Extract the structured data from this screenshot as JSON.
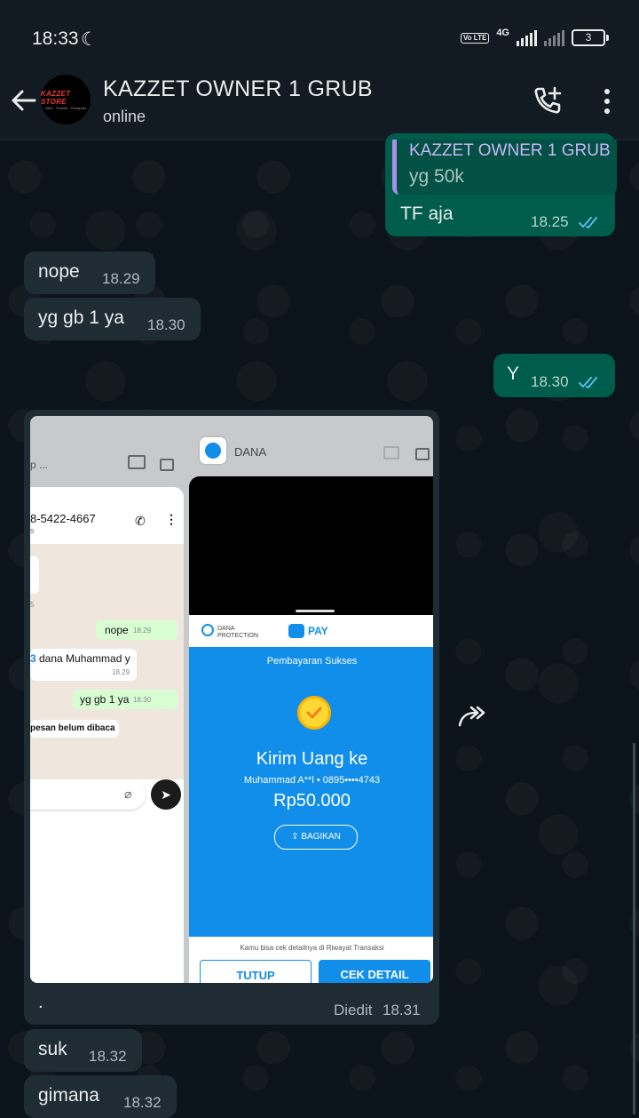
{
  "status": {
    "time": "18:33",
    "net": "4G",
    "volte": "Vo LTE",
    "battery": "3"
  },
  "header": {
    "title": "KAZZET OWNER 1 GRUB",
    "status": "online",
    "avatar_text": "KAZZET STORE",
    "avatar_sub": "Best · Trusted · Cheapest"
  },
  "messages": {
    "m1": {
      "quote_name": "KAZZET OWNER 1 GRUB",
      "quote_text": "yg 50k",
      "text": "TF aja",
      "time": "18.25"
    },
    "m2": {
      "text": "nope",
      "time": "18.29"
    },
    "m3": {
      "text": "yg gb 1 ya",
      "time": "18.30"
    },
    "m4": {
      "text": "Y",
      "time": "18.30"
    },
    "m5": {
      "caption": ".",
      "edited": "Diedit",
      "time": "18.31"
    },
    "m6": {
      "text": "suk",
      "time": "18.32"
    },
    "m7": {
      "text": "gimana",
      "time": "18.32"
    }
  },
  "screenshot": {
    "left_app_label": "p ...",
    "phone": "8-5422-4667",
    "phone_sub": "s",
    "mini_time_side": "5",
    "chat_nope": "nope",
    "chat_nope_time": "18.29",
    "chat_msg": "dana Muhammad y",
    "chat_msg_num": "3",
    "chat_msg_time": "18.29",
    "chat_yg": "yg gb 1 ya",
    "chat_yg_time": "18.30",
    "unread": "pesan belum dibaca",
    "dana_app": "DANA",
    "dana_protection": "DANA PROTECTION",
    "pay": "PAY",
    "success": "Pembayaran Sukses",
    "kirim": "Kirim Uang ke",
    "recipient": "Muhammad A**l • 0895••••4743",
    "amount": "Rp50.000",
    "share": "BAGIKAN",
    "note": "Kamu bisa cek detailnya di Riwayat Transaksi",
    "close_btn": "TUTUP",
    "detail_btn": "CEK DETAIL"
  }
}
